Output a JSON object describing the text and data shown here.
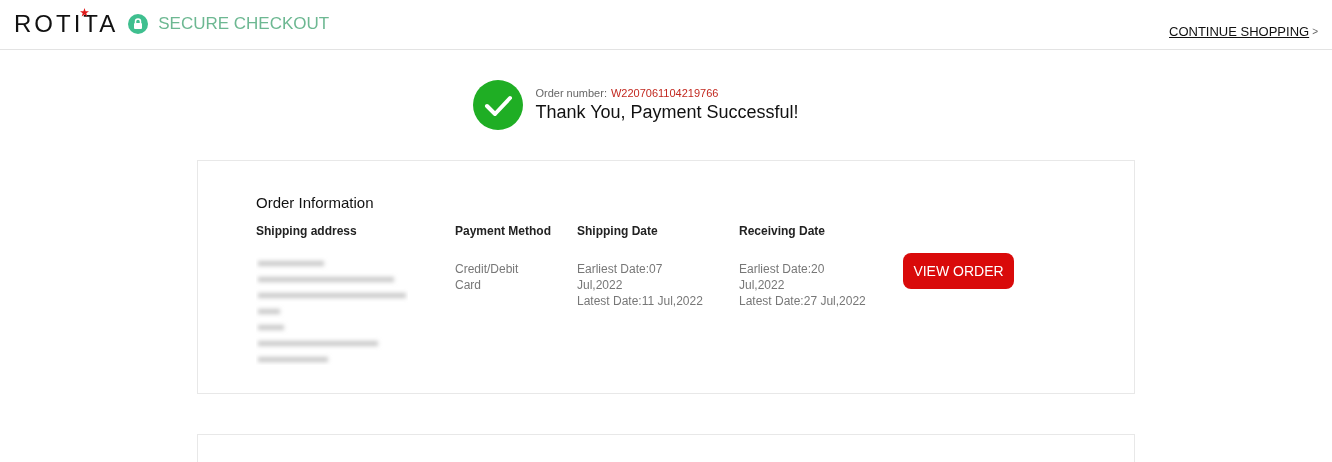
{
  "header": {
    "logo": "ROTITA",
    "secure_label": "SECURE CHECKOUT",
    "continue_link": "CONTINUE SHOPPING",
    "continue_arrow": ">"
  },
  "confirmation": {
    "order_label": "Order number:",
    "order_number": "W2207061104219766",
    "message": "Thank You, Payment Successful!"
  },
  "order_info": {
    "title": "Order Information",
    "columns": [
      {
        "heading": "Shipping address",
        "kind": "redacted"
      },
      {
        "heading": "Payment Method",
        "kind": "text",
        "lines": [
          "Credit/Debit",
          "Card"
        ]
      },
      {
        "heading": "Shipping Date",
        "kind": "text",
        "lines": [
          "Earliest Date:07",
          "Jul,2022",
          "Latest Date:11 Jul,2022"
        ]
      },
      {
        "heading": "Receiving Date",
        "kind": "text",
        "lines": [
          "Earliest Date:20",
          "Jul,2022",
          "Latest Date:27 Jul,2022"
        ]
      }
    ],
    "button": "VIEW ORDER"
  }
}
